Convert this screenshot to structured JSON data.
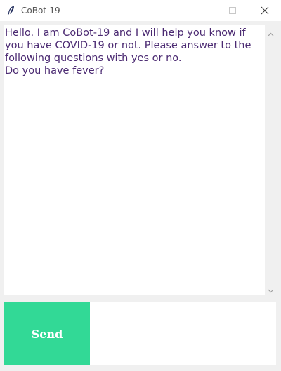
{
  "window": {
    "title": "CoBot-19",
    "controls": {
      "minimize": "minimize-icon",
      "maximize": "maximize-icon",
      "close": "close-icon"
    }
  },
  "chat": {
    "log": "Hello. I am CoBot-19 and I will help you know if you have COVID-19 or not. Please answer to the following questions with yes or no.\nDo you have fever?",
    "text_color": "#4b2a72"
  },
  "composer": {
    "send_label": "Send",
    "send_color": "#32d996",
    "input_value": ""
  }
}
